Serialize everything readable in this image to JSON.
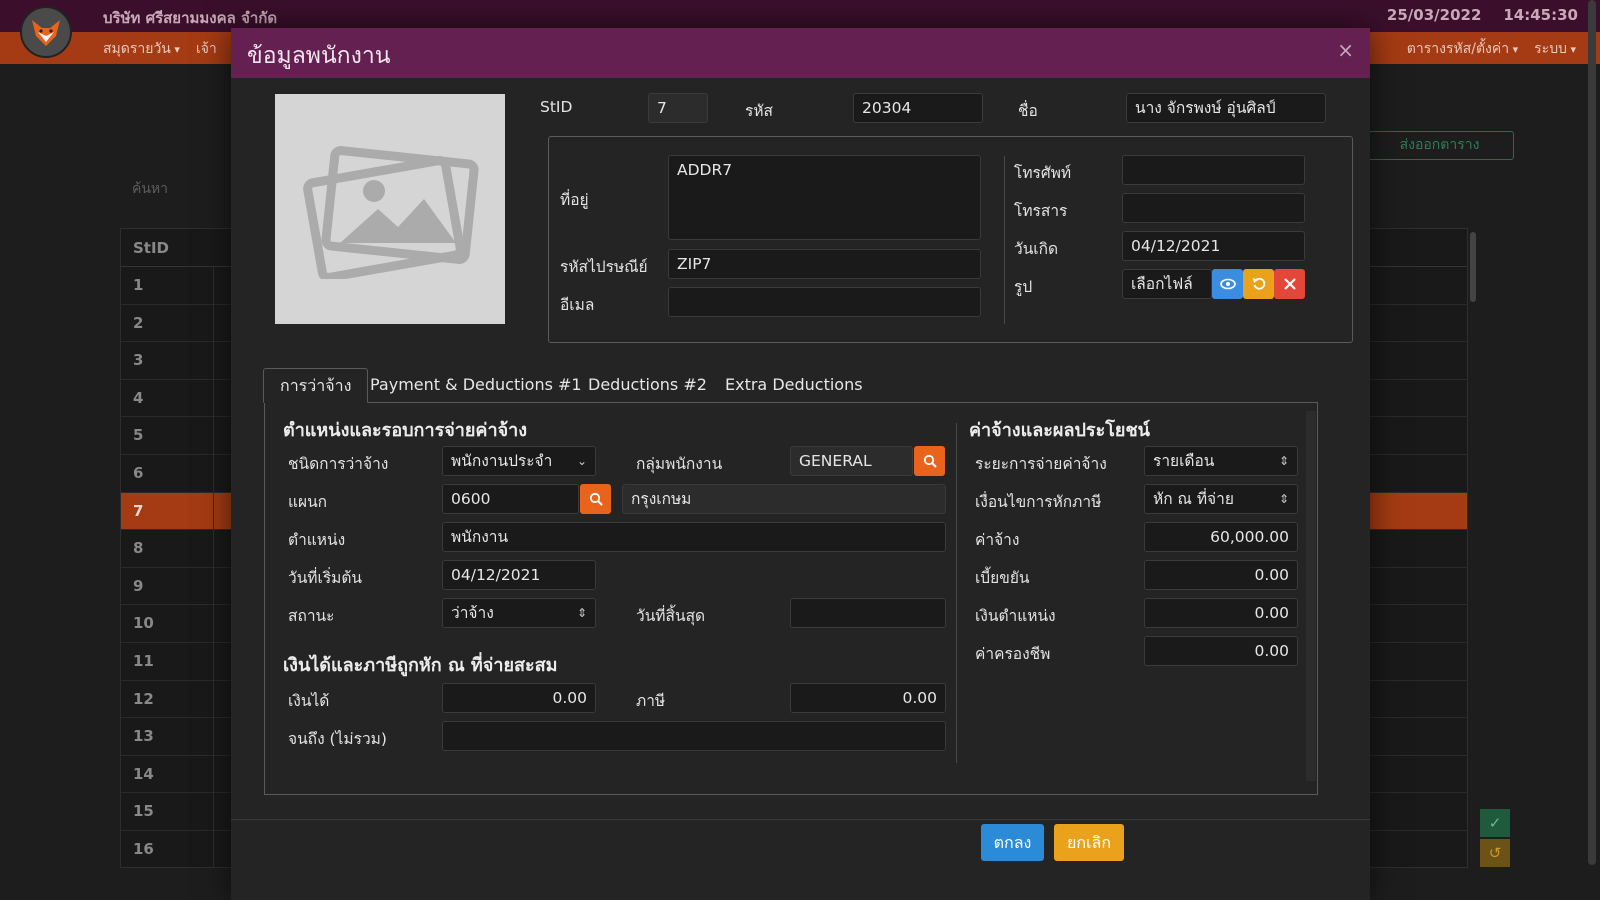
{
  "app": {
    "company": "บริษัท ศรีสยามมงคล จำกัด",
    "date": "25/03/2022",
    "time": "14:45:30",
    "nav_left": [
      "สมุดรายวัน",
      "เจ้า"
    ],
    "nav_right": [
      "ตารางรหัส/ตั้งค่า",
      "ระบบ"
    ],
    "export_label": "ส่งออกตาราง",
    "search_label": "ค้นหา",
    "table_header": "StID",
    "table_rows": [
      "1",
      "2",
      "3",
      "4",
      "5",
      "6",
      "7",
      "8",
      "9",
      "10",
      "11",
      "12",
      "13",
      "14",
      "15",
      "16"
    ],
    "selected_row": "7"
  },
  "modal": {
    "title": "ข้อมูลพนักงาน",
    "close": "×",
    "fields": {
      "stid_label": "StID",
      "stid": "7",
      "code_label": "รหัส",
      "code": "20304",
      "name_label": "ชื่อ",
      "name": "นาง จักรพงษ์ อุ่นศิลป์",
      "address_label": "ที่อยู่",
      "address": "ADDR7",
      "zip_label": "รหัสไปรษณีย์",
      "zip": "ZIP7",
      "email_label": "อีเมล",
      "email": "",
      "phone_label": "โทรศัพท์",
      "phone": "",
      "fax_label": "โทรสาร",
      "fax": "",
      "birth_label": "วันเกิด",
      "birth": "04/12/2021",
      "photo_label": "รูป",
      "photo_file": "เลือกไฟล์"
    },
    "tabs": [
      "การว่าจ้าง",
      "Payment & Deductions #1",
      "Deductions #2",
      "Extra Deductions"
    ],
    "employment": {
      "section_title": "ตำแหน่งและรอบการจ่ายค่าจ้าง",
      "type_label": "ชนิดการว่าจ้าง",
      "type": "พนักงานประจำ",
      "group_label": "กลุ่มพนักงาน",
      "group": "GENERAL",
      "dept_label": "แผนก",
      "dept_code": "0600",
      "dept_name": "กรุงเกษม",
      "position_label": "ตำแหน่ง",
      "position": "พนักงาน",
      "start_label": "วันที่เริ่มต้น",
      "start": "04/12/2021",
      "status_label": "สถานะ",
      "status": "ว่าจ้าง",
      "end_label": "วันที่สิ้นสุด",
      "end": ""
    },
    "accum": {
      "section_title": "เงินได้และภาษีถูกหัก ณ ที่จ่ายสะสม",
      "income_label": "เงินได้",
      "income": "0.00",
      "tax_label": "ภาษี",
      "tax": "0.00",
      "until_label": "จนถึง (ไม่รวม)",
      "until": ""
    },
    "pay": {
      "section_title": "ค่าจ้างและผลประโยชน์",
      "period_label": "ระยะการจ่ายค่าจ้าง",
      "period": "รายเดือน",
      "taxcond_label": "เงื่อนไขการหักภาษี",
      "taxcond": "หัก ณ ที่จ่าย",
      "wage_label": "ค่าจ้าง",
      "wage": "60,000.00",
      "allowance_label": "เบี้ยขยัน",
      "allowance": "0.00",
      "position_pay_label": "เงินตำแหน่ง",
      "position_pay": "0.00",
      "living_label": "ค่าครองชีพ",
      "living": "0.00"
    },
    "buttons": {
      "ok": "ตกลง",
      "cancel": "ยกเลิก"
    }
  },
  "colors": {
    "header": "#652052",
    "nav": "#a53b14",
    "accent_orange": "#e8631c",
    "ok_blue": "#2b8bd6",
    "cancel_yellow": "#eaa21d"
  }
}
